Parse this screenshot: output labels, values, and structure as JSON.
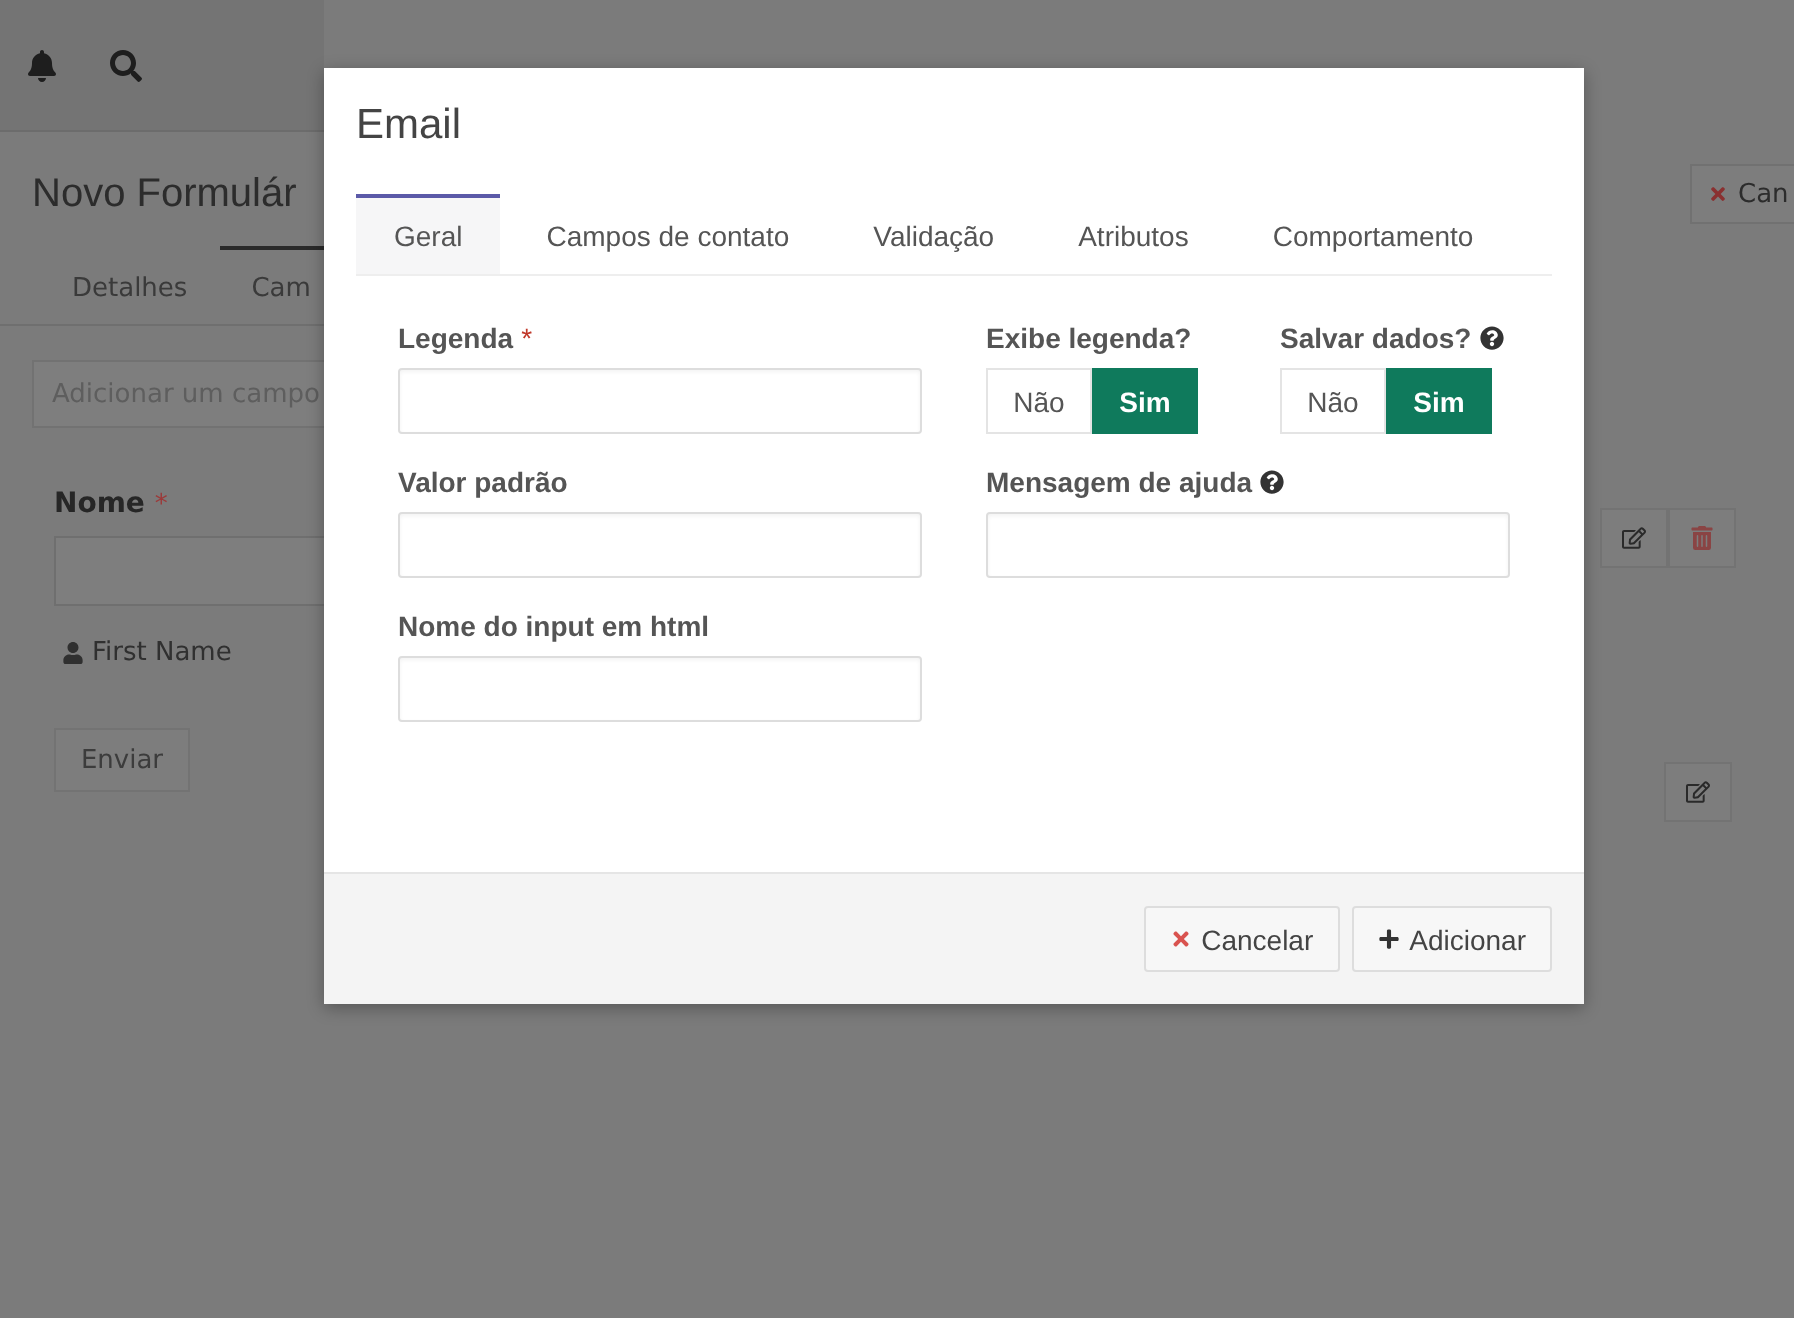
{
  "page": {
    "title": "Novo Formulár",
    "tabs": [
      {
        "label": "Detalhes",
        "selected": false
      },
      {
        "label": "Cam",
        "selected": true
      }
    ],
    "add_field": {
      "placeholder": "Adicionar um campo"
    },
    "field": {
      "label": "Nome",
      "required_mark": "*",
      "hint": "First Name"
    },
    "submit": "Enviar",
    "cancel": "Can"
  },
  "modal": {
    "title": "Email",
    "tabs": [
      {
        "label": "Geral",
        "selected": true
      },
      {
        "label": "Campos de contato",
        "selected": false
      },
      {
        "label": "Validação",
        "selected": false
      },
      {
        "label": "Atributos",
        "selected": false
      },
      {
        "label": "Comportamento",
        "selected": false
      }
    ],
    "rows": [
      {
        "cells": [
          {
            "kind": "input",
            "label": "Legenda",
            "required_mark": "*",
            "help": false
          },
          {
            "kind": "toggle",
            "label": "Exibe legenda?",
            "help": false,
            "options": [
              {
                "label": "Não",
                "selected": false
              },
              {
                "label": "Sim",
                "selected": true
              }
            ]
          },
          {
            "kind": "toggle",
            "label": "Salvar dados?",
            "help": true,
            "options": [
              {
                "label": "Não",
                "selected": false
              },
              {
                "label": "Sim",
                "selected": true
              }
            ]
          }
        ]
      },
      {
        "cells": [
          {
            "kind": "input",
            "label": "Valor padrão",
            "help": false
          },
          {
            "kind": "input",
            "label": "Mensagem de ajuda",
            "help": true
          }
        ]
      },
      {
        "cells": [
          {
            "kind": "input",
            "label": "Nome do input em html",
            "help": false
          }
        ]
      }
    ],
    "buttons": [
      {
        "kind": "cancel",
        "label": "Cancelar"
      },
      {
        "kind": "add",
        "label": "Adicionar"
      }
    ]
  }
}
